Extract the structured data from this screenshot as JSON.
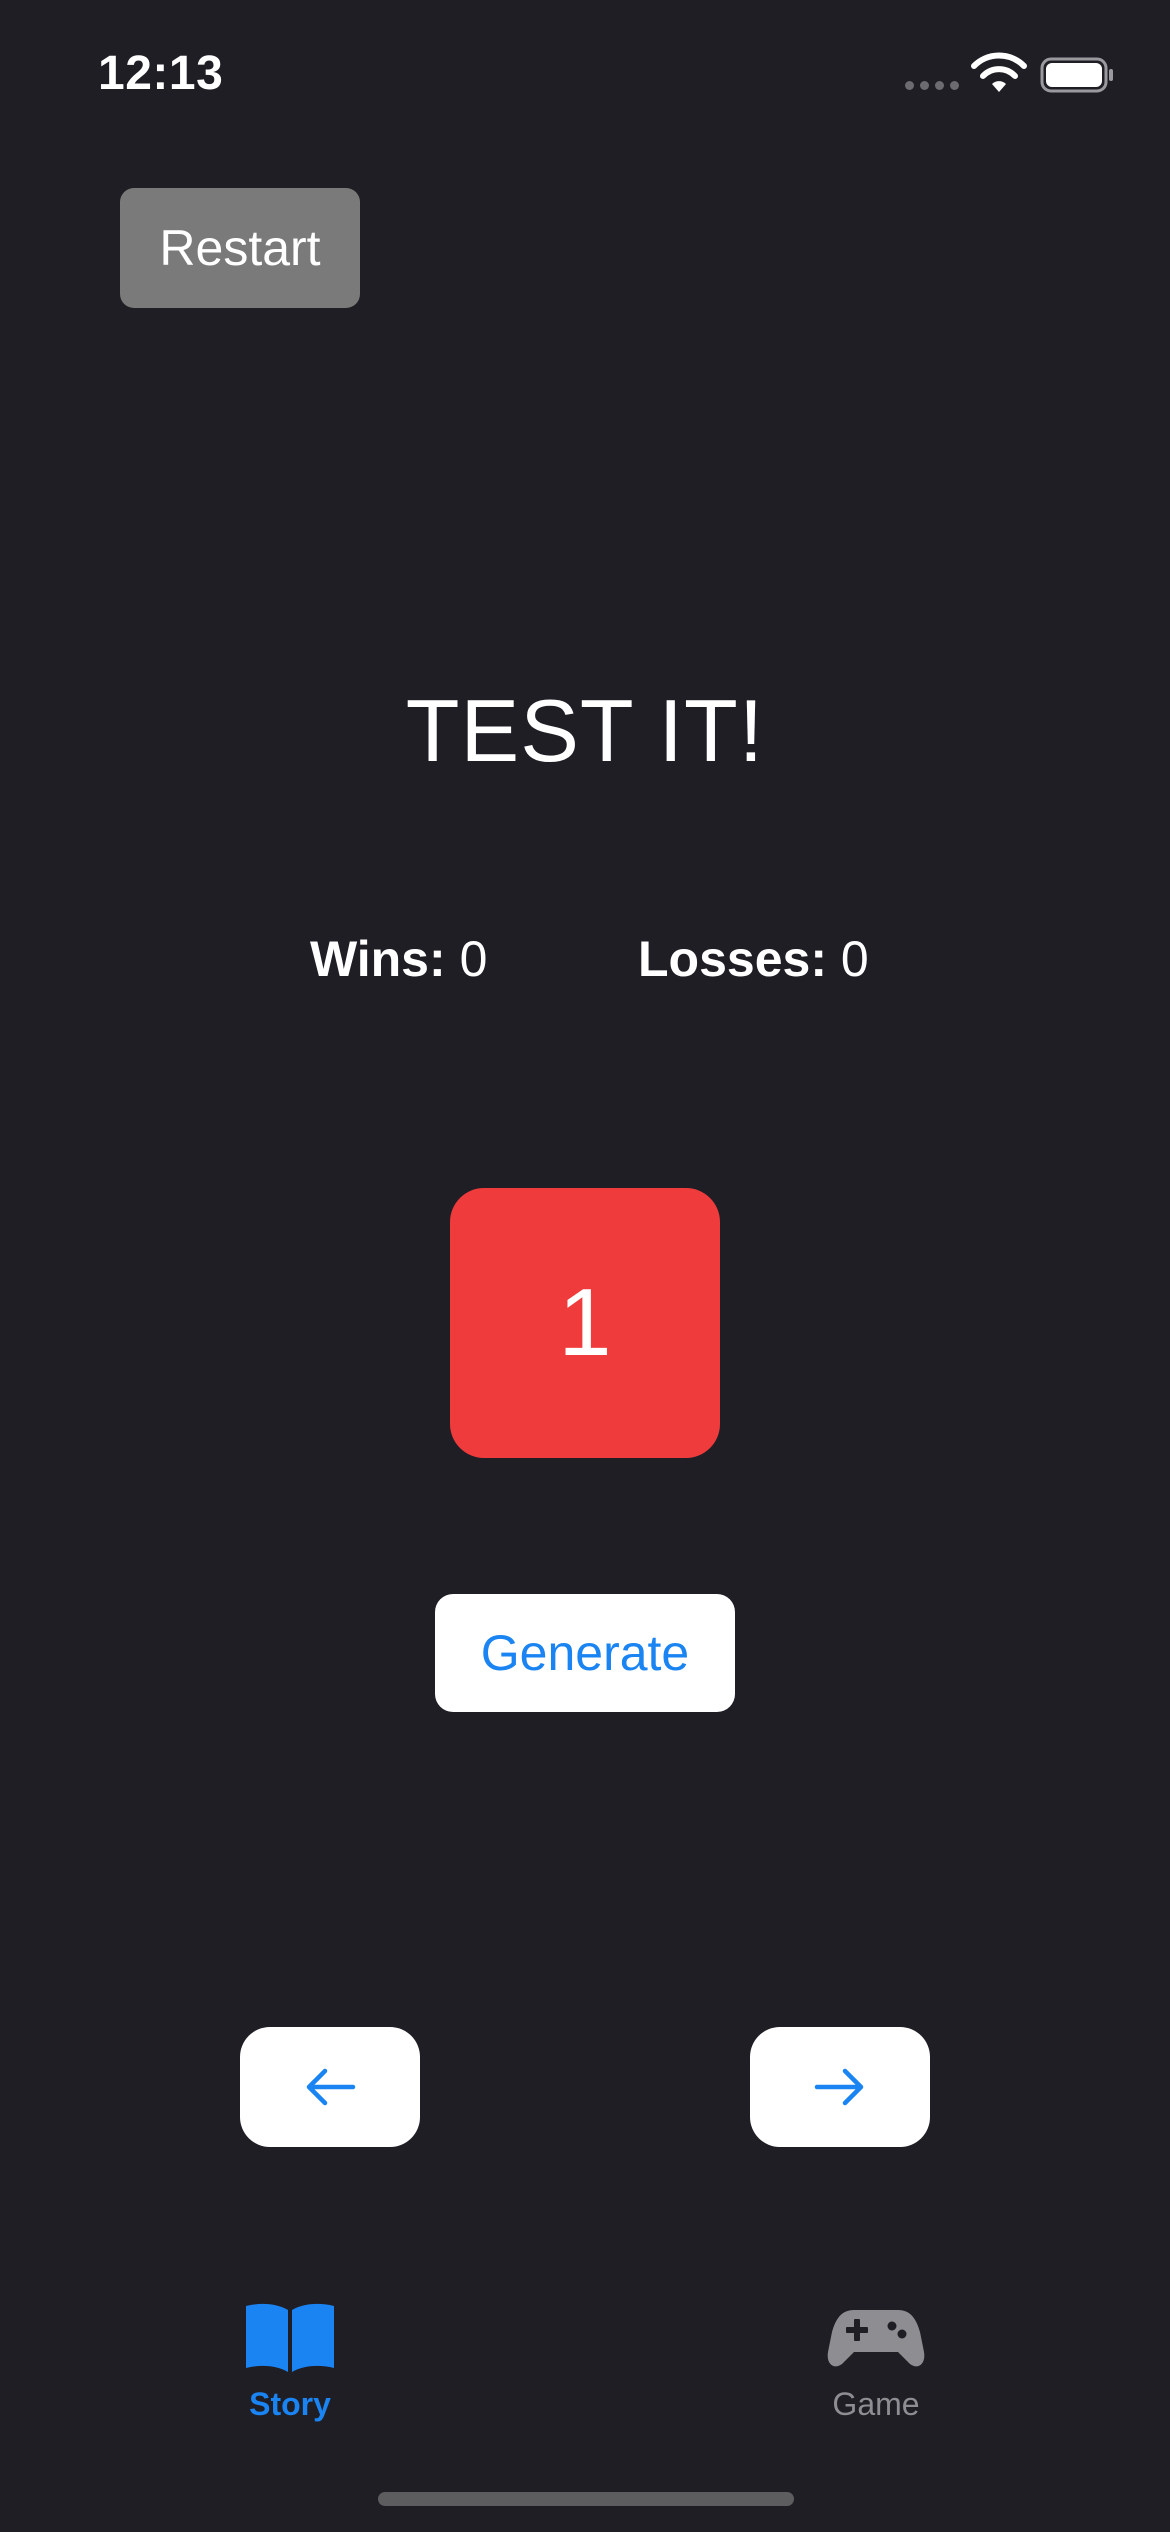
{
  "status_bar": {
    "time": "12:13",
    "signal_icon": "cellular-signal-icon",
    "wifi_icon": "wifi-icon",
    "battery_icon": "battery-icon"
  },
  "toolbar": {
    "restart_label": "Restart"
  },
  "main": {
    "title": "TEST IT!",
    "wins_label": "Wins:",
    "wins_value": "0",
    "losses_label": "Losses:",
    "losses_value": "0",
    "number": "1",
    "generate_label": "Generate"
  },
  "navigation": {
    "prev_icon": "arrow-left-icon",
    "next_icon": "arrow-right-icon"
  },
  "tab_bar": {
    "tabs": [
      {
        "label": "Story",
        "icon": "book-icon",
        "selected": true
      },
      {
        "label": "Game",
        "icon": "gamecontroller-icon",
        "selected": false
      }
    ]
  },
  "colors": {
    "background": "#1f1e25",
    "accent": "#1a84f2",
    "tile_red": "#ef3b3b",
    "restart_gray": "#7a7a7a",
    "inactive_gray": "#8d8d92"
  }
}
